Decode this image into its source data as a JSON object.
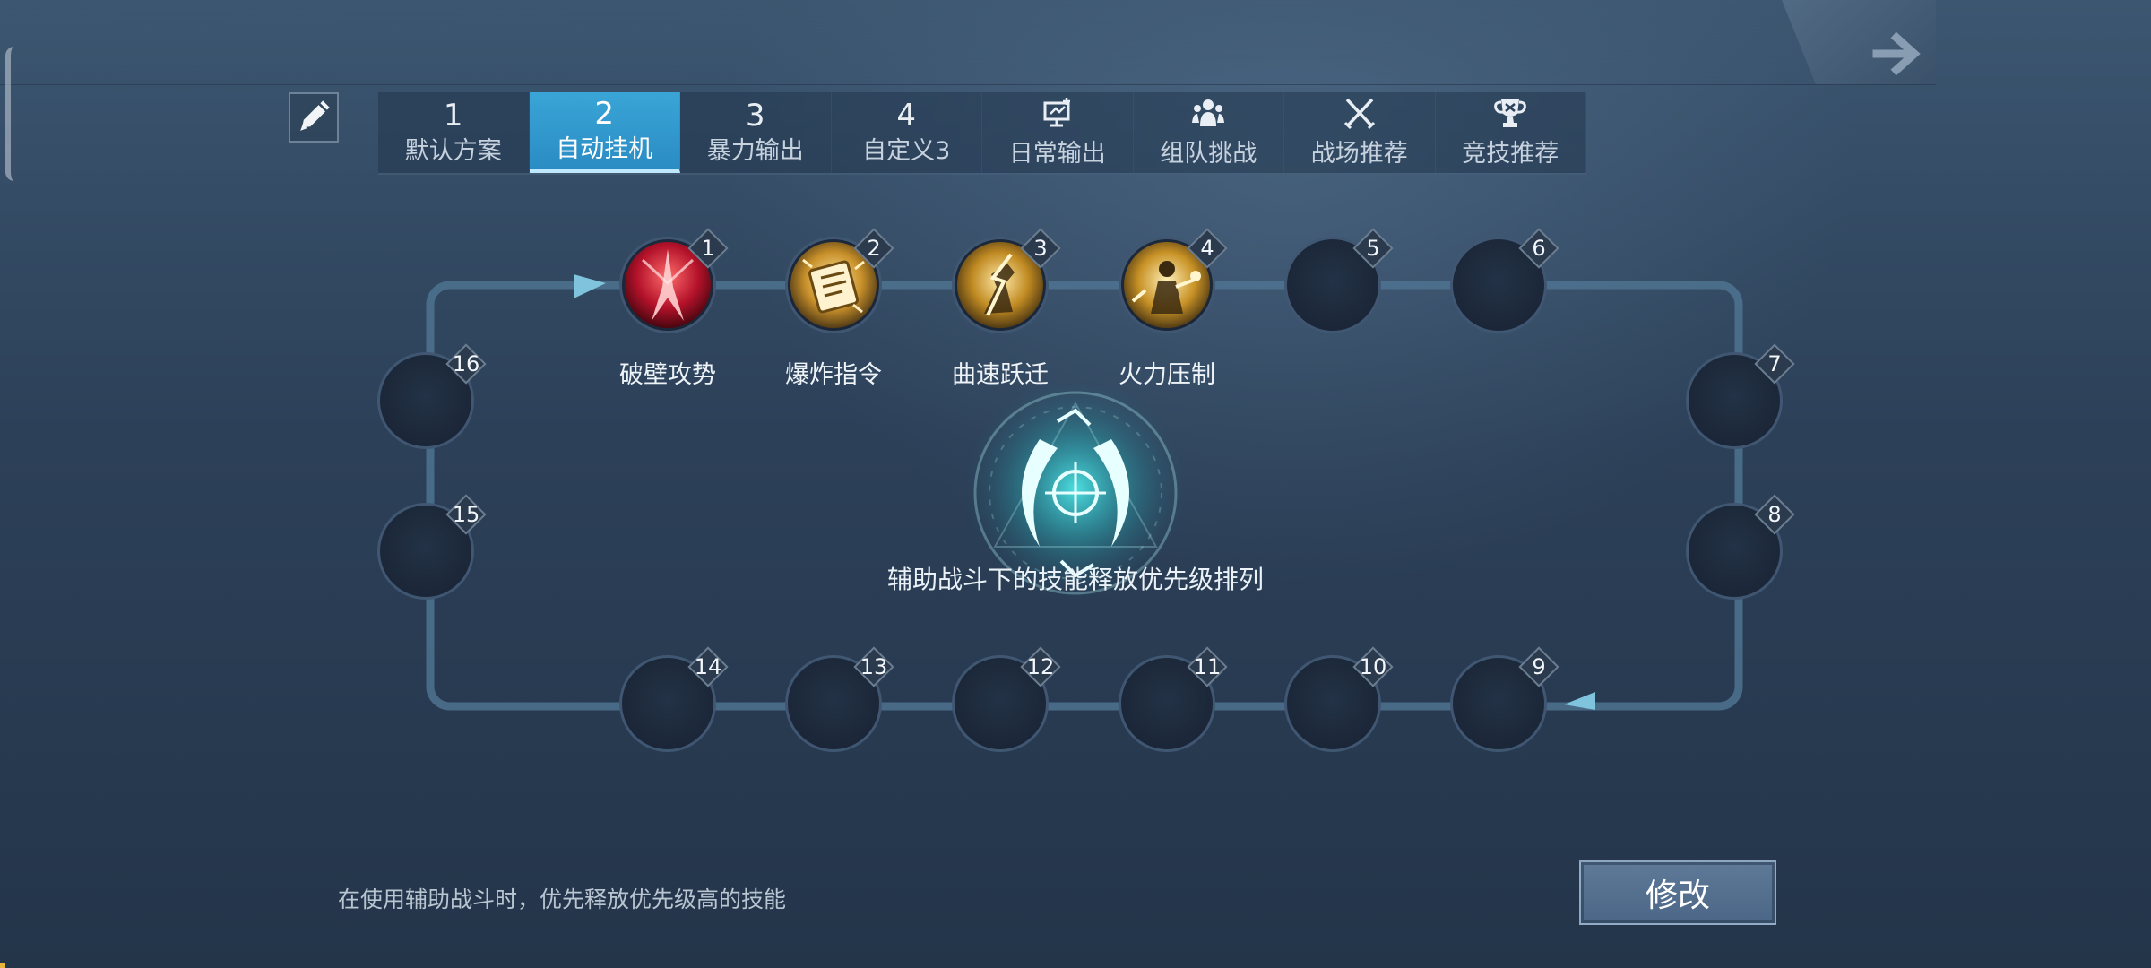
{
  "tabs": [
    {
      "num": "1",
      "label": "默认方案",
      "active": false
    },
    {
      "num": "2",
      "label": "自动挂机",
      "active": true
    },
    {
      "num": "3",
      "label": "暴力输出",
      "active": false
    },
    {
      "num": "4",
      "label": "自定义3",
      "active": false
    },
    {
      "icon": "screen-plus-icon",
      "label": "日常输出",
      "active": false
    },
    {
      "icon": "team-icon",
      "label": "组队挑战",
      "active": false
    },
    {
      "icon": "crossed-swords-icon",
      "label": "战场推荐",
      "active": false
    },
    {
      "icon": "trophy-icon",
      "label": "竞技推荐",
      "active": false
    }
  ],
  "slots": [
    {
      "n": "1",
      "skill": "破壁攻势"
    },
    {
      "n": "2",
      "skill": "爆炸指令"
    },
    {
      "n": "3",
      "skill": "曲速跃迁"
    },
    {
      "n": "4",
      "skill": "火力压制"
    },
    {
      "n": "5"
    },
    {
      "n": "6"
    },
    {
      "n": "7"
    },
    {
      "n": "8"
    },
    {
      "n": "9"
    },
    {
      "n": "10"
    },
    {
      "n": "11"
    },
    {
      "n": "12"
    },
    {
      "n": "13"
    },
    {
      "n": "14"
    },
    {
      "n": "15"
    },
    {
      "n": "16"
    }
  ],
  "center": {
    "caption": "辅助战斗下的技能释放优先级排列"
  },
  "footer": {
    "hint": "在使用辅助战斗时，优先释放优先级高的技能",
    "modify_label": "修改"
  },
  "colors": {
    "active_tab": "#2a8cc3",
    "track": "#5a7f9c",
    "emblem": "#3fe0e0"
  }
}
